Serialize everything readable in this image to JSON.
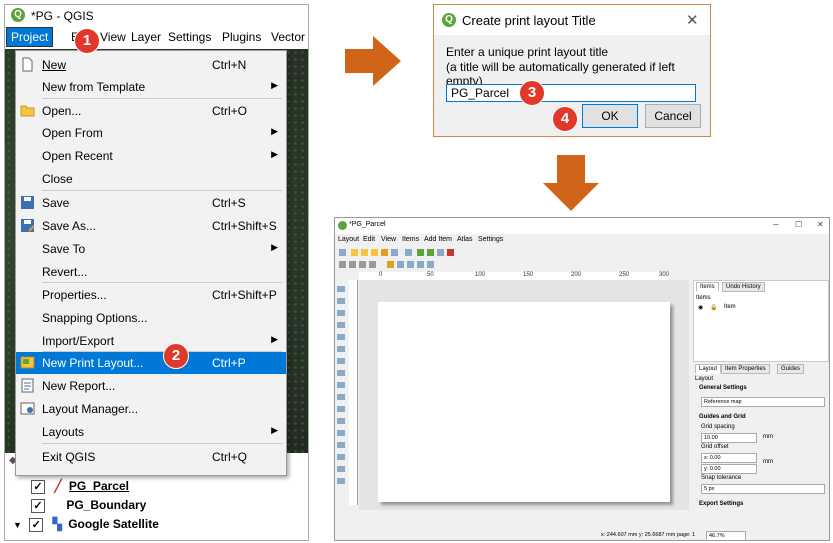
{
  "qgis": {
    "window_title": "*PG - QGIS",
    "menubar": [
      "Project",
      "Edit",
      "View",
      "Layer",
      "Settings",
      "Plugins",
      "Vector"
    ],
    "menu_items": [
      {
        "label": "New",
        "shortcut": "Ctrl+N",
        "icon": "new-file-icon"
      },
      {
        "label": "New from Template",
        "submenu": true
      },
      {
        "label": "Open...",
        "shortcut": "Ctrl+O",
        "icon": "folder-icon"
      },
      {
        "label": "Open From",
        "submenu": true
      },
      {
        "label": "Open Recent",
        "submenu": true
      },
      {
        "label": "Close"
      },
      {
        "label": "Save",
        "shortcut": "Ctrl+S",
        "icon": "save-icon"
      },
      {
        "label": "Save As...",
        "shortcut": "Ctrl+Shift+S",
        "icon": "save-as-icon"
      },
      {
        "label": "Save To",
        "submenu": true
      },
      {
        "label": "Revert..."
      },
      {
        "label": "Properties...",
        "shortcut": "Ctrl+Shift+P"
      },
      {
        "label": "Snapping Options..."
      },
      {
        "label": "Import/Export",
        "submenu": true
      },
      {
        "label": "New Print Layout...",
        "shortcut": "Ctrl+P",
        "icon": "print-layout-icon",
        "highlighted": true
      },
      {
        "label": "New Report...",
        "icon": "report-icon"
      },
      {
        "label": "Layout Manager...",
        "icon": "layout-manager-icon"
      },
      {
        "label": "Layouts",
        "submenu": true
      },
      {
        "label": "Exit QGIS",
        "shortcut": "Ctrl+Q"
      }
    ],
    "layers": [
      "PG_Parcel",
      "PG_Boundary",
      "Google Satellite"
    ]
  },
  "steps": [
    "1",
    "2",
    "3",
    "4"
  ],
  "dialog": {
    "title": "Create print layout Title",
    "line1": "Enter a unique print layout title",
    "line2": "(a title will be automatically generated if left empty)",
    "input_value": "PG_Parcel",
    "ok_label": "OK",
    "cancel_label": "Cancel"
  },
  "layout": {
    "window_title": "*PG_Parcel",
    "menubar": [
      "Layout",
      "Edit",
      "View",
      "Items",
      "Add Item",
      "Atlas",
      "Settings"
    ],
    "ruler_labels": [
      "0",
      "50",
      "100",
      "150",
      "200",
      "250",
      "300"
    ],
    "items_tabs": [
      "Items",
      "Undo History"
    ],
    "items_header": "Items",
    "items_col": "Item",
    "props_tabs": [
      "Layout",
      "Item Properties",
      "Guides"
    ],
    "props_title": "Layout",
    "general_settings": "General Settings",
    "reference_map": "Reference map",
    "guides_grid": "Guides and Grid",
    "grid_spacing": "Grid spacing",
    "grid_spacing_value": "10.00",
    "grid_offset": "Grid offset",
    "offset_x": "x: 0.00",
    "offset_y": "y: 0.00",
    "unit": "mm",
    "snap_tolerance": "Snap tolerance",
    "snap_value": "5 px",
    "export_settings": "Export Settings",
    "status": "x: 244.607 mm y: 25.6687 mm page: 1",
    "zoom": "46.7%"
  },
  "colors": {
    "accent": "#0078d7",
    "badge": "#e0392b",
    "arrow": "#d0651a"
  }
}
